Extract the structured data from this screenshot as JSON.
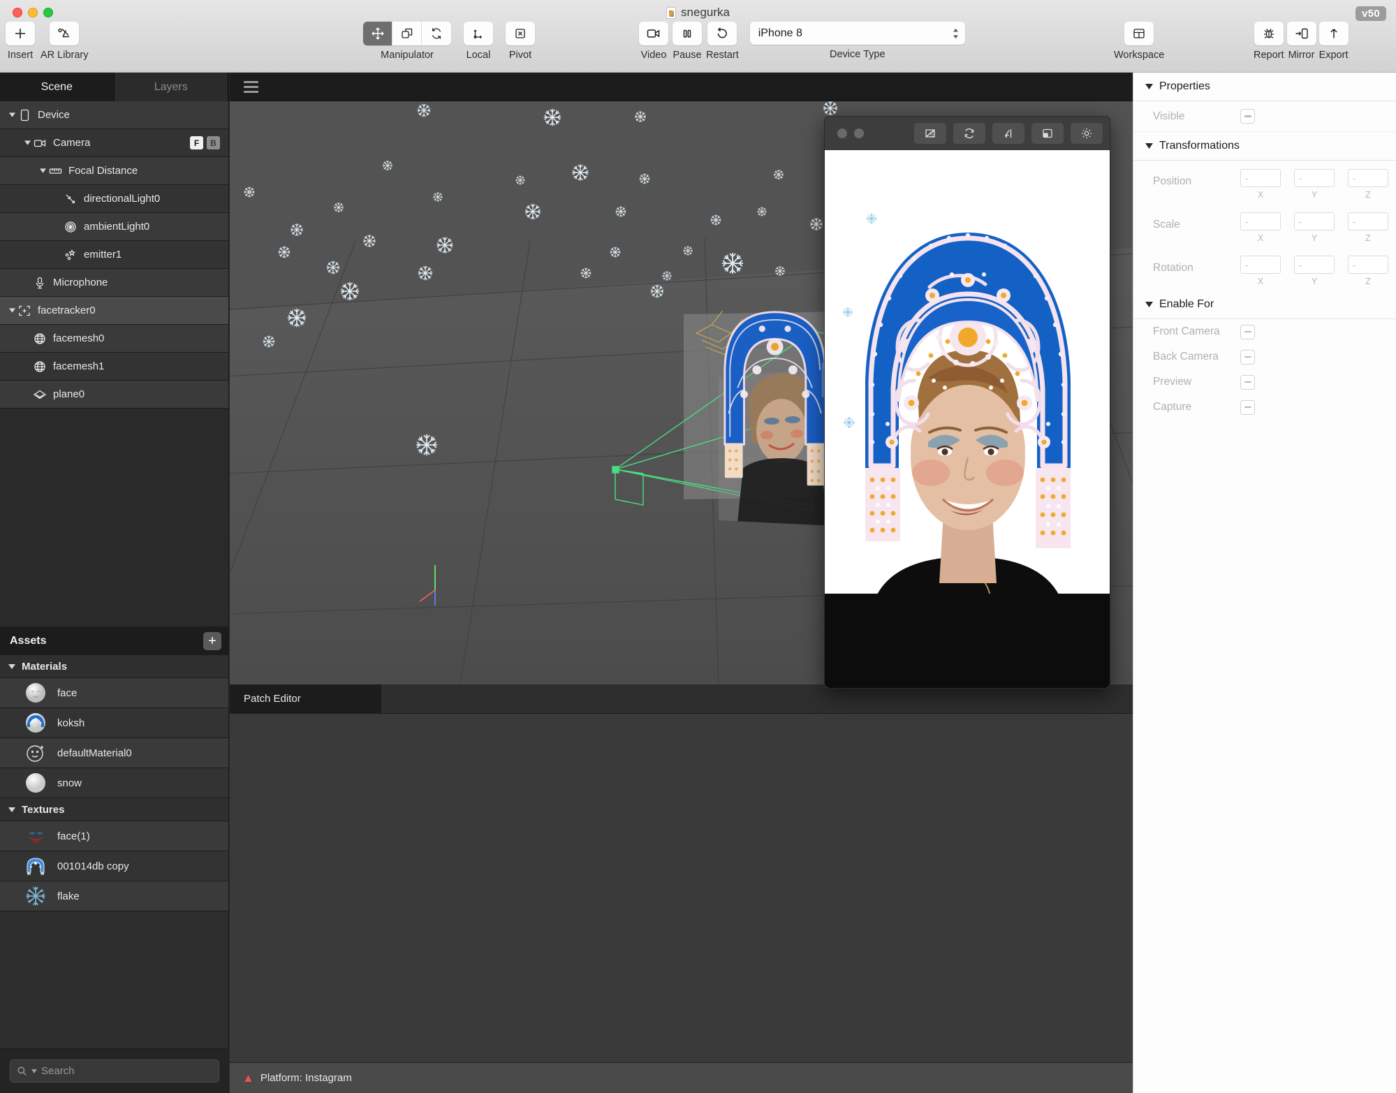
{
  "window": {
    "title": "snegurka",
    "version_badge": "v50",
    "traffic_lights": [
      "close",
      "minimize",
      "zoom"
    ]
  },
  "toolbar": {
    "left_items": [
      {
        "label": "Insert",
        "icon": "plus-icon"
      },
      {
        "label": "AR Library",
        "icon": "ar-library-icon"
      }
    ],
    "manipulator": {
      "label": "Manipulator",
      "modes": [
        {
          "name": "move",
          "icon": "move-icon",
          "active": true
        },
        {
          "name": "scale",
          "icon": "scale-icon",
          "active": false
        },
        {
          "name": "rotate",
          "icon": "rotate-icon",
          "active": false
        }
      ]
    },
    "coordinate_space": {
      "label": "Local",
      "icon": "axis-icon"
    },
    "pivot": {
      "label": "Pivot",
      "icon": "pivot-icon"
    },
    "playback": [
      {
        "label": "Video",
        "icon": "video-camera-icon"
      },
      {
        "label": "Pause",
        "icon": "pause-icon"
      },
      {
        "label": "Restart",
        "icon": "restart-icon"
      }
    ],
    "device_type": {
      "label": "Device Type",
      "value": "iPhone 8"
    },
    "workspace": {
      "label": "Workspace",
      "icon": "layout-icon"
    },
    "right_items": [
      {
        "label": "Report",
        "icon": "bug-icon"
      },
      {
        "label": "Mirror",
        "icon": "mirror-icon"
      },
      {
        "label": "Export",
        "icon": "upload-arrow-icon"
      }
    ]
  },
  "left_panel": {
    "tabs": [
      {
        "label": "Scene",
        "active": true
      },
      {
        "label": "Layers",
        "active": false
      }
    ],
    "scene_tree": [
      {
        "label": "Device",
        "icon": "device-icon",
        "indent": 0,
        "expanded": true,
        "selected": false,
        "tags": []
      },
      {
        "label": "Camera",
        "icon": "camera-icon",
        "indent": 1,
        "expanded": true,
        "selected": false,
        "tags": [
          "F",
          "B"
        ]
      },
      {
        "label": "Focal Distance",
        "icon": "ruler-icon",
        "indent": 2,
        "expanded": true,
        "selected": false,
        "tags": []
      },
      {
        "label": "directionalLight0",
        "icon": "directional-light-icon",
        "indent": 3,
        "expanded": null,
        "selected": false,
        "tags": []
      },
      {
        "label": "ambientLight0",
        "icon": "ambient-light-icon",
        "indent": 3,
        "expanded": null,
        "selected": false,
        "tags": []
      },
      {
        "label": "emitter1",
        "icon": "emitter-icon",
        "indent": 3,
        "expanded": null,
        "selected": false,
        "tags": []
      },
      {
        "label": "Microphone",
        "icon": "microphone-icon",
        "indent": 1,
        "expanded": null,
        "selected": false,
        "tags": []
      },
      {
        "label": "facetracker0",
        "icon": "facetracker-icon",
        "indent": 0,
        "expanded": true,
        "selected": true,
        "tags": []
      },
      {
        "label": "facemesh0",
        "icon": "facemesh-icon",
        "indent": 1,
        "expanded": null,
        "selected": false,
        "tags": []
      },
      {
        "label": "facemesh1",
        "icon": "facemesh-icon",
        "indent": 1,
        "expanded": null,
        "selected": false,
        "tags": []
      },
      {
        "label": "plane0",
        "icon": "plane-icon",
        "indent": 1,
        "expanded": null,
        "selected": false,
        "tags": []
      }
    ],
    "assets": {
      "title": "Assets",
      "add_button": "+",
      "groups": [
        {
          "name": "Materials",
          "items": [
            {
              "label": "face",
              "thumb": "material-face-sphere"
            },
            {
              "label": "koksh",
              "thumb": "material-koksh-sphere"
            },
            {
              "label": "defaultMaterial0",
              "thumb": "default-material-icon"
            },
            {
              "label": "snow",
              "thumb": "material-snow-sphere"
            }
          ]
        },
        {
          "name": "Textures",
          "items": [
            {
              "label": "face(1)",
              "thumb": "texture-face-makeup"
            },
            {
              "label": "001014db copy",
              "thumb": "texture-kokoshnik"
            },
            {
              "label": "flake",
              "thumb": "texture-snowflake"
            }
          ]
        }
      ]
    },
    "search": {
      "placeholder": "Search",
      "value": "",
      "icon": "search-icon"
    }
  },
  "viewport": {
    "menu_icon": "hamburger-icon",
    "background_color": "#535353",
    "selection_color": "#4ade80",
    "axis_gizmo": {
      "x_color": "#e05c5c",
      "y_color": "#5ce05c",
      "z_color": "#5c7ce0"
    }
  },
  "patch_editor": {
    "tab_label": "Patch Editor"
  },
  "status_bar": {
    "icon": "warning-icon",
    "text": "Platform: Instagram",
    "icon_color": "#e8564f"
  },
  "simulator": {
    "toolbar_buttons": [
      {
        "name": "no-background-icon"
      },
      {
        "name": "reload-icon"
      },
      {
        "name": "resize-icon"
      },
      {
        "name": "picture-in-picture-icon"
      },
      {
        "name": "settings-gear-icon"
      }
    ],
    "window_dots": 2,
    "content_description": "Face effect preview: woman wearing blue kokoshnik headdress with snow particles"
  },
  "right_panel": {
    "sections": [
      {
        "title": "Properties",
        "expanded": true,
        "rows": [
          {
            "label": "Visible",
            "type": "checkbox",
            "state": "indeterminate"
          }
        ]
      },
      {
        "title": "Transformations",
        "expanded": true,
        "transforms": [
          {
            "label": "Position",
            "axes": [
              "X",
              "Y",
              "Z"
            ],
            "values": [
              "-",
              "-",
              "-"
            ]
          },
          {
            "label": "Scale",
            "axes": [
              "X",
              "Y",
              "Z"
            ],
            "values": [
              "-",
              "-",
              "-"
            ]
          },
          {
            "label": "Rotation",
            "axes": [
              "X",
              "Y",
              "Z"
            ],
            "values": [
              "-",
              "-",
              "-"
            ]
          }
        ]
      },
      {
        "title": "Enable For",
        "expanded": true,
        "rows": [
          {
            "label": "Front Camera",
            "type": "checkbox",
            "state": "indeterminate"
          },
          {
            "label": "Back Camera",
            "type": "checkbox",
            "state": "indeterminate"
          },
          {
            "label": "Preview",
            "type": "checkbox",
            "state": "indeterminate"
          },
          {
            "label": "Capture",
            "type": "checkbox",
            "state": "indeterminate"
          }
        ]
      }
    ]
  }
}
